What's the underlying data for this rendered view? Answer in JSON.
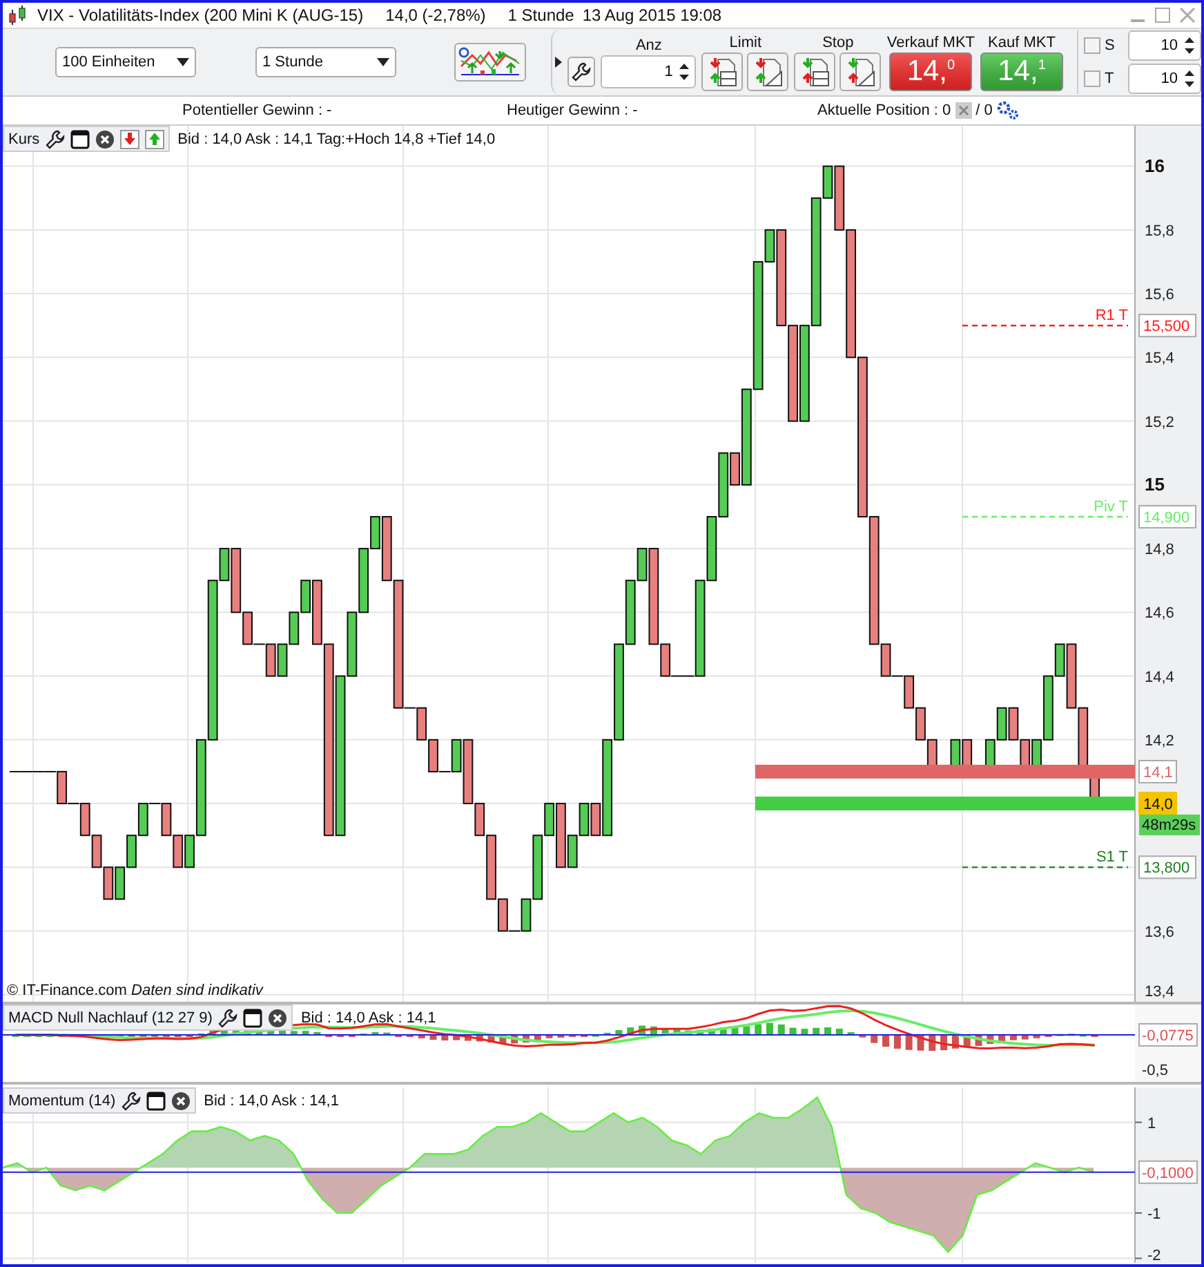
{
  "window": {
    "title": "VIX - Volatilitäts-Index (200 Mini K (AUG-15)",
    "quote": "14,0 (-2,78%)",
    "interval": "1 Stunde",
    "datetime": "13 Aug 2015 19:08"
  },
  "toolbar": {
    "quantity": "100 Einheiten",
    "timeframe": "1 Stunde",
    "anz": {
      "label": "Anz",
      "value": "1"
    },
    "limit": {
      "label": "Limit"
    },
    "stop": {
      "label": "Stop"
    },
    "sell": {
      "label": "Verkauf MKT",
      "price": "14,",
      "decimal": "0"
    },
    "buy": {
      "label": "Kauf MKT",
      "price": "14,",
      "decimal": "1"
    },
    "options": [
      {
        "label": "S",
        "checked": false,
        "value": "10"
      },
      {
        "label": "T",
        "checked": false,
        "value": "10"
      }
    ]
  },
  "info_bar": {
    "potential": "Potentieller Gewinn : -",
    "today": "Heutiger Gewinn : -",
    "position": "Aktuelle Position : 0",
    "position_count": "/ 0"
  },
  "price_panel": {
    "title": "Kurs",
    "quote": "Bid : 14,0 Ask : 14,1 Tag:+Hoch 14,8 +Tief 14,0",
    "copyright": "© IT-Finance.com",
    "disclaimer": "Daten sind indikativ",
    "axis_labels": [
      "16",
      "15,8",
      "15,6",
      "15,4",
      "15,2",
      "15",
      "14,8",
      "14,6",
      "14,4",
      "14,2",
      "13,6",
      "13,4"
    ],
    "levels": [
      {
        "label": "R1 T",
        "tag": "15,500",
        "color": "#ff2020"
      },
      {
        "label": "Piv T",
        "tag": "14,900",
        "color": "#66ee66"
      },
      {
        "label": "S1 T",
        "tag": "13,800",
        "color": "#208020"
      }
    ],
    "quotes": [
      {
        "kind": "ask",
        "tag": "14,1",
        "color": "#e06666"
      },
      {
        "kind": "bid",
        "tag": "14,0",
        "color": "#44cc44",
        "timer": "48m29s"
      }
    ]
  },
  "macd_panel": {
    "title": "MACD Null Nachlauf (12 27 9)",
    "quote": "Bid : 14,0 Ask : 14,1",
    "readout": "-0,0775",
    "tick": "-0,5"
  },
  "momentum_panel": {
    "quote": "Bid : 14,0 Ask : 14,1",
    "chart_data": {
      "type": "area",
      "ylim": [
        -2.1,
        1.77
      ],
      "yticks": [
        1,
        -1,
        -2
      ],
      "grid": true,
      "series": [
        {
          "name": "Momentum (14)",
          "color": "#66ee44",
          "values": [
            0.0,
            0.1,
            -0.1,
            0.0,
            -0.4,
            -0.5,
            -0.4,
            -0.5,
            -0.3,
            -0.1,
            0.1,
            0.3,
            0.6,
            0.8,
            0.8,
            0.9,
            0.8,
            0.6,
            0.7,
            0.6,
            0.3,
            -0.3,
            -0.7,
            -1.0,
            -1.0,
            -0.7,
            -0.4,
            -0.2,
            0.0,
            0.3,
            0.3,
            0.3,
            0.4,
            0.7,
            0.9,
            0.9,
            1.0,
            1.2,
            1.0,
            0.8,
            0.8,
            1.0,
            1.2,
            1.0,
            1.1,
            0.9,
            0.6,
            0.5,
            0.3,
            0.6,
            0.7,
            1.0,
            1.2,
            1.1,
            1.1,
            1.3,
            1.55,
            0.9,
            -0.6,
            -0.9,
            -1.0,
            -1.2,
            -1.3,
            -1.4,
            -1.5,
            -1.86,
            -1.5,
            -0.6,
            -0.5,
            -0.3,
            -0.1,
            0.1,
            0.0,
            -0.1,
            0.0,
            -0.1
          ]
        }
      ],
      "ref_lines": [
        {
          "axis": "y",
          "value": -0.1,
          "label": "-0,1000",
          "color": "#2020e0"
        }
      ]
    }
  }
}
